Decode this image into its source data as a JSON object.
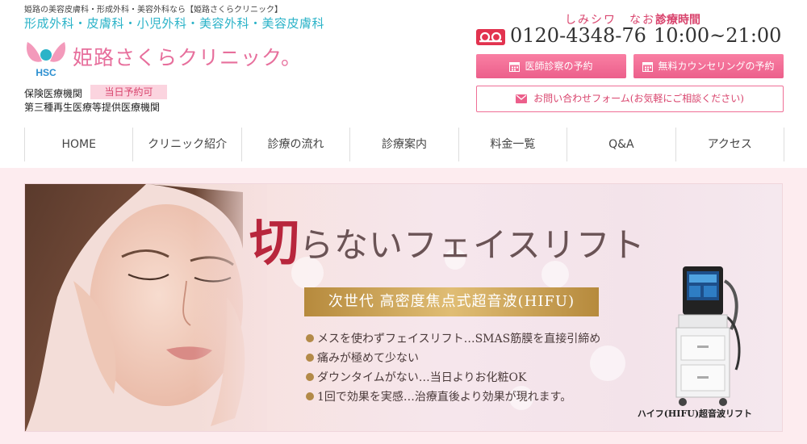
{
  "header": {
    "tagline": "姫路の美容皮膚科・形成外科・美容外科なら【姫路さくらクリニック】",
    "departments": "形成外科・皮膚科・小児外科・美容外科・美容皮膚科",
    "logo_abbr": "HSC",
    "clinic_name": "姫路さくらクリニック。",
    "insurance_label": "保険医療機関",
    "same_day_badge": "当日予約可",
    "regen_label": "第三種再生医療等提供医療機関"
  },
  "contact": {
    "phone_kana": "しみシワ　なおる",
    "hours_label": "診療時間",
    "phone": "0120-4348-76",
    "hours": "10:00~21:00",
    "doctor_button": "医師診察の予約",
    "counseling_button": "無料カウンセリングの予約",
    "inquiry_button": "お問い合わせフォーム(お気軽にご相談ください)"
  },
  "nav": {
    "items": [
      "HOME",
      "クリニック紹介",
      "診療の流れ",
      "診療案内",
      "料金一覧",
      "Q&A",
      "アクセス"
    ]
  },
  "banner": {
    "headline_first": "切",
    "headline_rest": "らないフェイスリフト",
    "subtitle": "次世代 高密度焦点式超音波(HIFU)",
    "bullets": [
      "メスを使わずフェイスリフト…SMAS筋膜を直接引締め",
      "痛みが極めて少ない",
      "ダウンタイムがない…当日よりお化粧OK",
      "1回で効果を実感…治療直後より効果が現れます。"
    ],
    "device_caption": "ハイフ(HIFU)超音波リフト"
  },
  "colors": {
    "accent_pink": "#ec5f8b",
    "teal": "#2bb3c8",
    "gold": "#c9a35a",
    "headline_red": "#b8263c"
  }
}
